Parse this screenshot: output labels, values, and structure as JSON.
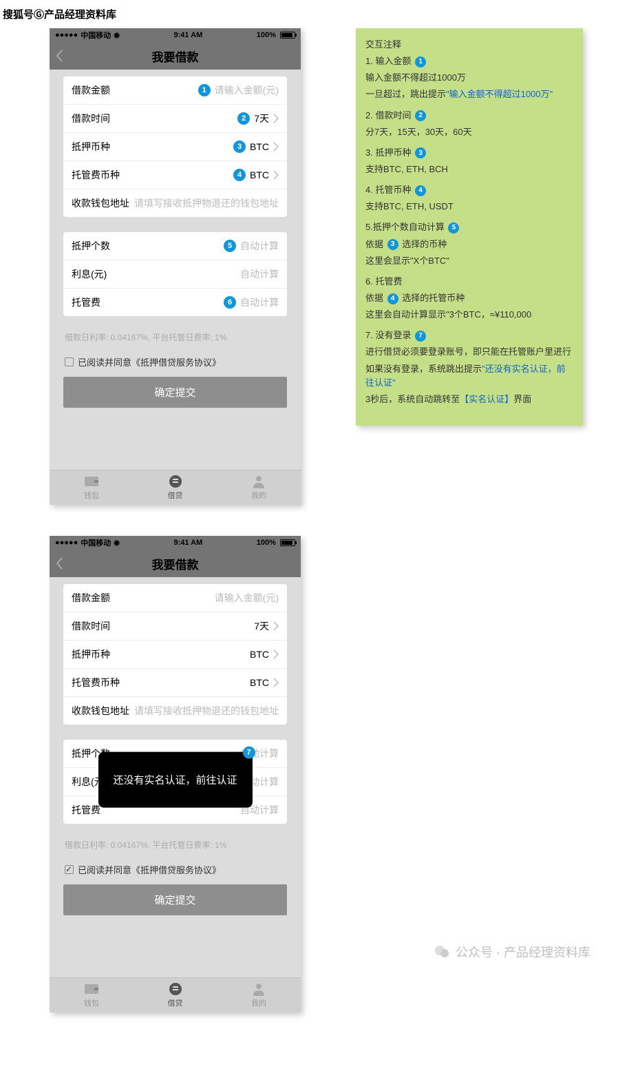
{
  "page_header": "搜狐号Ⓖ产品经理资料库",
  "status": {
    "carrier": "中国移动",
    "time": "9:41 AM",
    "battery": "100%"
  },
  "nav": {
    "title": "我要借款"
  },
  "badges": {
    "b1": "1",
    "b2": "2",
    "b3": "3",
    "b4": "4",
    "b5": "5",
    "b6": "6",
    "b7": "7"
  },
  "form": {
    "amount_label": "借款金额",
    "amount_placeholder": "请输入金额(元)",
    "duration_label": "借款时间",
    "duration_value": "7天",
    "collateral_label": "抵押币种",
    "collateral_value": "BTC",
    "custody_label": "托管费币种",
    "custody_value": "BTC",
    "wallet_label": "收款钱包地址",
    "wallet_placeholder": "请填写接收抵押物退还的钱包地址",
    "count_label": "抵押个数",
    "interest_label": "利息(元)",
    "fee_label": "托管费",
    "auto_calc": "自动计算"
  },
  "rate_note": "借款日利率: 0.04167%, 平台托管日费率: 1%",
  "agree_text": "已阅读并同意《抵押借贷服务协议》",
  "submit_label": "确定提交",
  "tabs": {
    "wallet": "钱包",
    "loan": "借贷",
    "mine": "我的"
  },
  "toast_text": "还没有实名认证，前往认证",
  "notes": {
    "title": "交互注释",
    "s1_t": "1. 输入金额",
    "s1_l1": "输入金额不得超过1000万",
    "s1_l2a": "一旦超过，跳出提示",
    "s1_l2b": "\"输入金额不得超过1000万\"",
    "s2_t": "2. 借款时间",
    "s2_l1": "分7天，15天，30天，60天",
    "s3_t": "3. 抵押币种",
    "s3_l1": "支持BTC, ETH, BCH",
    "s4_t": "4. 托管币种",
    "s4_l1": "支持BTC, ETH, USDT",
    "s5_t": "5.抵押个数自动计算",
    "s5_l1a": "依据",
    "s5_l1b": "选择的币种",
    "s5_l2": "这里会显示\"X个BTC\"",
    "s6_t": "6. 托管费",
    "s6_l1a": "依据",
    "s6_l1b": "选择的托管币种",
    "s6_l2": "这里会自动计算显示\"3个BTC，≈¥110,000",
    "s7_t": "7. 没有登录",
    "s7_l1": "进行借贷必须要登录账号，即只能在托管账户里进行",
    "s7_l2a": "如果没有登录，系统跳出提示",
    "s7_l2b": "\"还没有实名认证，前往认证\"",
    "s7_l3a": "3秒后，系统自动跳转至",
    "s7_l3b": "【实名认证】",
    "s7_l3c": "界面"
  },
  "watermark": "公众号 · 产品经理资料库"
}
